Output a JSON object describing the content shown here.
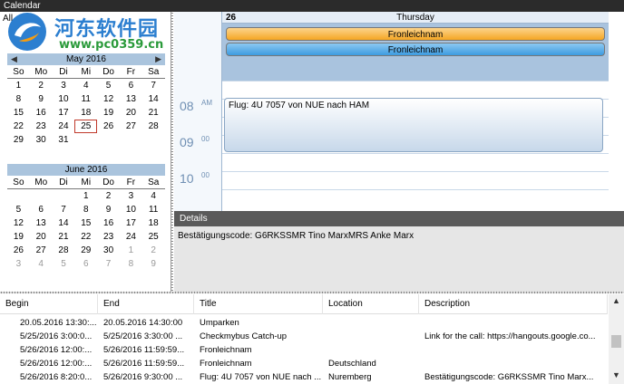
{
  "window": {
    "title": "Calendar"
  },
  "watermark": {
    "title": "河东软件园",
    "url": "www.pc0359.cn"
  },
  "left_panel": {
    "allday_label": "All"
  },
  "may": {
    "title": "May 2016",
    "dow": [
      "So",
      "Mo",
      "Di",
      "Mi",
      "Do",
      "Fr",
      "Sa"
    ],
    "weeks": [
      [
        "1",
        "2",
        "3",
        "4",
        "5",
        "6",
        "7"
      ],
      [
        "8",
        "9",
        "10",
        "11",
        "12",
        "13",
        "14"
      ],
      [
        "15",
        "16",
        "17",
        "18",
        "19",
        "20",
        "21"
      ],
      [
        "22",
        "23",
        "24",
        "25",
        "26",
        "27",
        "28"
      ],
      [
        "29",
        "30",
        "31",
        "",
        "",
        "",
        ""
      ]
    ]
  },
  "june": {
    "title": "June 2016",
    "dow": [
      "So",
      "Mo",
      "Di",
      "Mi",
      "Do",
      "Fr",
      "Sa"
    ],
    "weeks": [
      [
        "",
        "",
        "",
        "1",
        "2",
        "3",
        "4"
      ],
      [
        "5",
        "6",
        "7",
        "8",
        "9",
        "10",
        "11"
      ],
      [
        "12",
        "13",
        "14",
        "15",
        "16",
        "17",
        "18"
      ],
      [
        "19",
        "20",
        "21",
        "22",
        "23",
        "24",
        "25"
      ],
      [
        "26",
        "27",
        "28",
        "29",
        "30",
        "1",
        "2"
      ],
      [
        "3",
        "4",
        "5",
        "6",
        "7",
        "8",
        "9"
      ]
    ]
  },
  "day_view": {
    "day_number": "26",
    "day_name": "Thursday",
    "allday_events": [
      {
        "title": "Fronleichnam"
      },
      {
        "title": "Fronleichnam"
      }
    ],
    "hours": [
      {
        "hour": "08",
        "suffix": "AM"
      },
      {
        "hour": "09",
        "suffix": "00"
      },
      {
        "hour": "10",
        "suffix": "00"
      }
    ],
    "timed_event": {
      "title": "Flug: 4U 7057 von NUE nach HAM"
    }
  },
  "details": {
    "header": "Details",
    "text": "Bestätigungscode: G6RKSSMR Tino MarxMRS Anke Marx"
  },
  "event_list": {
    "columns": [
      "Begin",
      "End",
      "Title",
      "Location",
      "Description"
    ],
    "rows": [
      [
        "20.05.2016 13:30:...",
        "20.05.2016 14:30:00",
        "Umparken",
        "",
        ""
      ],
      [
        "5/25/2016 3:00:0...",
        "5/25/2016 3:30:00 ...",
        "Checkmybus Catch-up",
        "",
        "Link for the call: https://hangouts.google.co..."
      ],
      [
        "5/26/2016 12:00:...",
        "5/26/2016 11:59:59...",
        "Fronleichnam",
        "",
        ""
      ],
      [
        "5/26/2016 12:00:...",
        "5/26/2016 11:59:59...",
        "Fronleichnam",
        "Deutschland",
        ""
      ],
      [
        "5/26/2016 8:20:0...",
        "5/26/2016 9:30:00 ...",
        "Flug: 4U 7057 von NUE nach ...",
        "Nuremberg",
        "Bestätigungscode: G6RKSSMR Tino Marx..."
      ]
    ]
  }
}
